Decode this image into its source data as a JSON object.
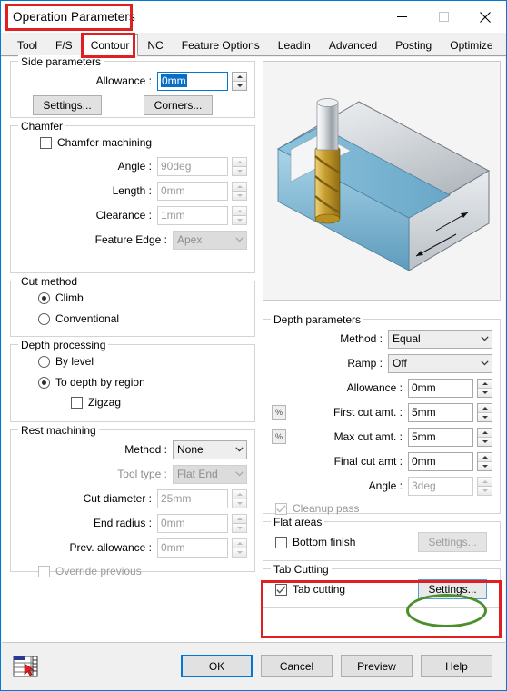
{
  "window": {
    "title": "Operation Parameters",
    "minimize_icon": "minimize-icon",
    "maximize_icon": "maximize-icon",
    "close_icon": "close-icon"
  },
  "tabs": [
    {
      "label": "Tool",
      "active": false
    },
    {
      "label": "F/S",
      "active": false
    },
    {
      "label": "Contour",
      "active": true
    },
    {
      "label": "NC",
      "active": false
    },
    {
      "label": "Feature Options",
      "active": false
    },
    {
      "label": "Leadin",
      "active": false
    },
    {
      "label": "Advanced",
      "active": false
    },
    {
      "label": "Posting",
      "active": false
    },
    {
      "label": "Optimize",
      "active": false
    }
  ],
  "side_parameters": {
    "legend": "Side parameters",
    "allowance_label": "Allowance :",
    "allowance_value": "0mm",
    "settings_button": "Settings...",
    "corners_button": "Corners..."
  },
  "chamfer": {
    "legend": "Chamfer",
    "machining_label": "Chamfer machining",
    "machining_checked": false,
    "angle_label": "Angle :",
    "angle_value": "90deg",
    "length_label": "Length :",
    "length_value": "0mm",
    "clearance_label": "Clearance :",
    "clearance_value": "1mm",
    "feature_edge_label": "Feature Edge :",
    "feature_edge_value": "Apex"
  },
  "cut_method": {
    "legend": "Cut method",
    "options": [
      {
        "label": "Climb",
        "selected": true
      },
      {
        "label": "Conventional",
        "selected": false
      }
    ]
  },
  "depth_processing": {
    "legend": "Depth processing",
    "options": [
      {
        "label": "By level",
        "selected": false
      },
      {
        "label": "To depth by region",
        "selected": true
      }
    ],
    "zigzag_label": "Zigzag",
    "zigzag_checked": false
  },
  "rest_machining": {
    "legend": "Rest machining",
    "method_label": "Method :",
    "method_value": "None",
    "tool_type_label": "Tool type :",
    "tool_type_value": "Flat End",
    "cut_diameter_label": "Cut diameter :",
    "cut_diameter_value": "25mm",
    "end_radius_label": "End radius :",
    "end_radius_value": "0mm",
    "prev_allowance_label": "Prev. allowance :",
    "prev_allowance_value": "0mm",
    "override_label": "Override previous",
    "override_checked": false
  },
  "preview": {
    "name": "contour-milling-illustration",
    "body_color": "#c8cdd2",
    "highlight_color": "#7fb7d4",
    "tool_color": "#d4a83c"
  },
  "depth_parameters": {
    "legend": "Depth parameters",
    "method_label": "Method :",
    "method_value": "Equal",
    "ramp_label": "Ramp :",
    "ramp_value": "Off",
    "allowance_label": "Allowance :",
    "allowance_value": "0mm",
    "first_cut_label": "First cut amt. :",
    "first_cut_value": "5mm",
    "max_cut_label": "Max cut amt. :",
    "max_cut_value": "5mm",
    "final_cut_label": "Final cut amt :",
    "final_cut_value": "0mm",
    "angle_label": "Angle :",
    "angle_value": "3deg",
    "cleanup_label": "Cleanup pass",
    "cleanup_checked": true,
    "percent_symbol": "%"
  },
  "flat_areas": {
    "legend": "Flat areas",
    "bottom_finish_label": "Bottom finish",
    "bottom_finish_checked": false,
    "settings_button": "Settings..."
  },
  "tab_cutting": {
    "legend": "Tab Cutting",
    "tab_cutting_label": "Tab cutting",
    "tab_cutting_checked": true,
    "settings_button": "Settings..."
  },
  "footer": {
    "table_icon": "table-cursor-icon",
    "ok_button": "OK",
    "cancel_button": "Cancel",
    "preview_button": "Preview",
    "help_button": "Help"
  },
  "annotations": {
    "title_highlight": "red-rectangle",
    "contour_tab_highlight": "red-rectangle",
    "tab_cutting_highlight": "red-rectangle",
    "settings_highlight": "green-ellipse",
    "red": "#e02020",
    "green": "#4a8f2a"
  }
}
